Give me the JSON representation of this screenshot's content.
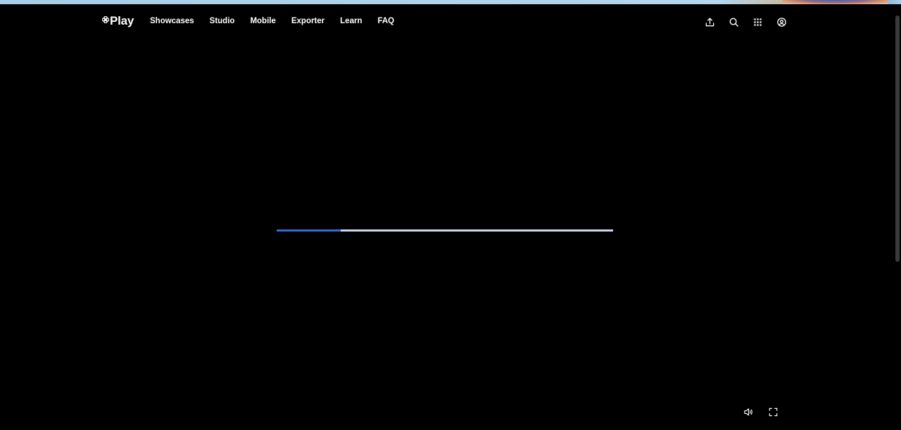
{
  "brand": {
    "logo_text": "Play",
    "logo_icon": "play-clover-icon"
  },
  "nav": {
    "items": [
      {
        "label": "Showcases"
      },
      {
        "label": "Studio"
      },
      {
        "label": "Mobile"
      },
      {
        "label": "Exporter"
      },
      {
        "label": "Learn"
      },
      {
        "label": "FAQ"
      }
    ]
  },
  "header_actions": {
    "icons": [
      "upload-icon",
      "search-icon",
      "apps-grid-icon",
      "account-icon"
    ]
  },
  "loader": {
    "progress_fraction": 0.19
  },
  "player_controls": {
    "icons": [
      "volume-icon",
      "fullscreen-icon"
    ]
  },
  "colors": {
    "background": "#000000",
    "text": "#ffffff",
    "progress_fill": "#2f6fd6",
    "progress_track": "#c8d9ee"
  }
}
